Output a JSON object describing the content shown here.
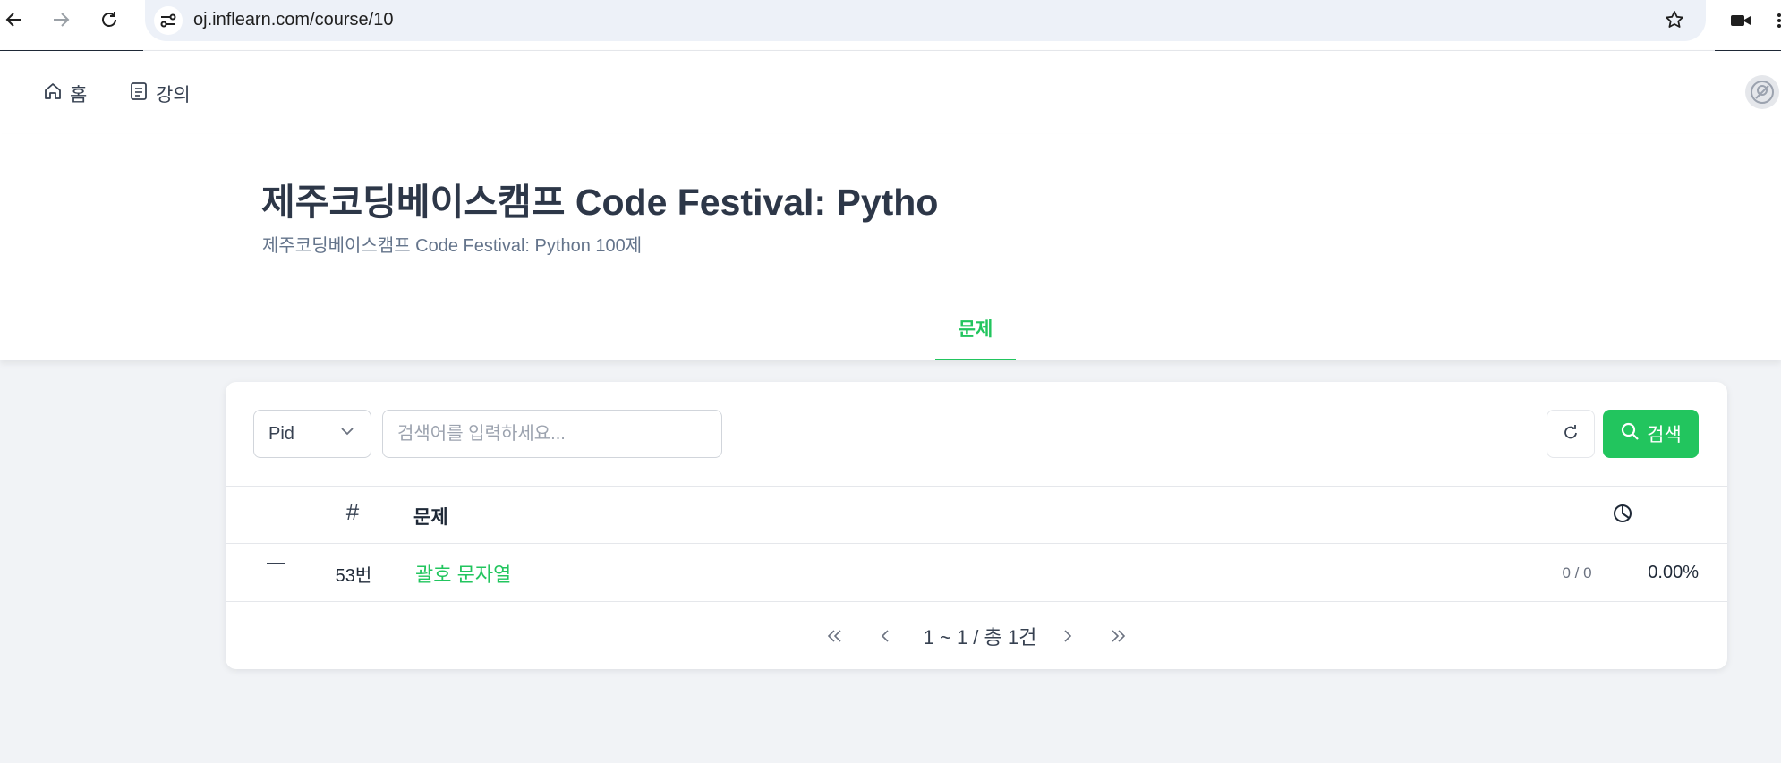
{
  "browser": {
    "url": "oj.inflearn.com/course/10"
  },
  "nav": {
    "home_label": "홈",
    "courses_label": "강의"
  },
  "course": {
    "title": "제주코딩베이스캠프 Code Festival: Pytho",
    "subtitle": "제주코딩베이스캠프 Code Festival: Python 100제",
    "tab_label": "문제"
  },
  "search": {
    "filter_value": "Pid",
    "placeholder": "검색어를 입력하세요...",
    "button_label": "검색"
  },
  "table": {
    "col_number": "#",
    "col_title": "문제",
    "rows": [
      {
        "number": "53번",
        "title": "괄호 문자열",
        "count": "0 / 0",
        "rate": "0.00%"
      }
    ]
  },
  "pagination": {
    "info": "1 ~ 1 / 총 1건"
  },
  "colors": {
    "accent": "#22c55e",
    "title": "#2d3748",
    "background": "#f1f3f6"
  }
}
